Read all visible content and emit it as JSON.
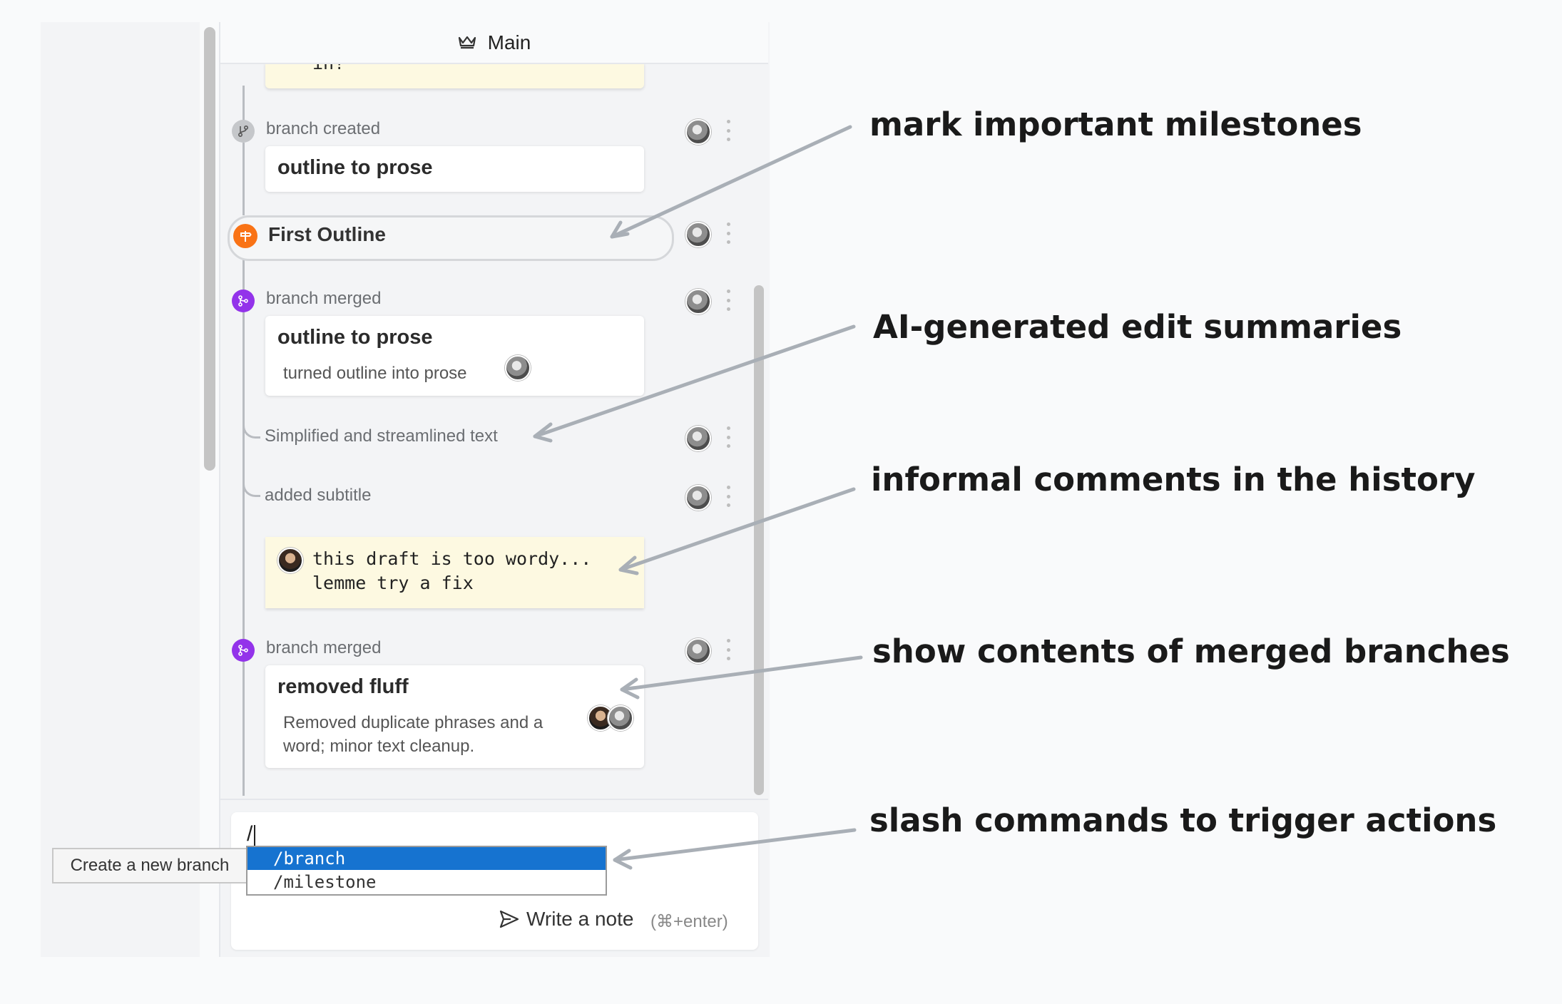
{
  "header": {
    "title": "Main"
  },
  "timeline": {
    "top_note_fragment": "in!",
    "branch_created": {
      "event": "branch created",
      "card_title": "outline to prose"
    },
    "milestone": {
      "label": "First Outline"
    },
    "merge1": {
      "event": "branch merged",
      "card_title": "outline to prose",
      "card_desc": "turned outline into prose"
    },
    "edit1": {
      "label": "Simplified and streamlined text"
    },
    "edit2": {
      "label": "added subtitle"
    },
    "comment": {
      "line1": "this draft is too wordy...",
      "line2": "lemme try a fix"
    },
    "merge2": {
      "event": "branch merged",
      "card_title": "removed fluff",
      "card_desc_line1": "Removed duplicate phrases and a",
      "card_desc_line2": "word; minor text cleanup."
    }
  },
  "composer": {
    "input_value": "/",
    "tooltip": "Create a new branch",
    "autocomplete": [
      {
        "label": "/branch",
        "selected": true
      },
      {
        "label": "/milestone",
        "selected": false
      }
    ],
    "send_label": "Write a note",
    "shortcut_hint": "(⌘+enter)"
  },
  "annotations": [
    {
      "text": "mark important milestones"
    },
    {
      "text": "AI-generated edit summaries"
    },
    {
      "text": "informal comments in the history"
    },
    {
      "text": "show contents of merged branches"
    },
    {
      "text": "slash commands to trigger actions"
    }
  ],
  "colors": {
    "accent_blue": "#1673d0",
    "merge_purple": "#9333ea",
    "milestone_orange": "#f97316",
    "comment_yellow": "#fdf9e1"
  }
}
